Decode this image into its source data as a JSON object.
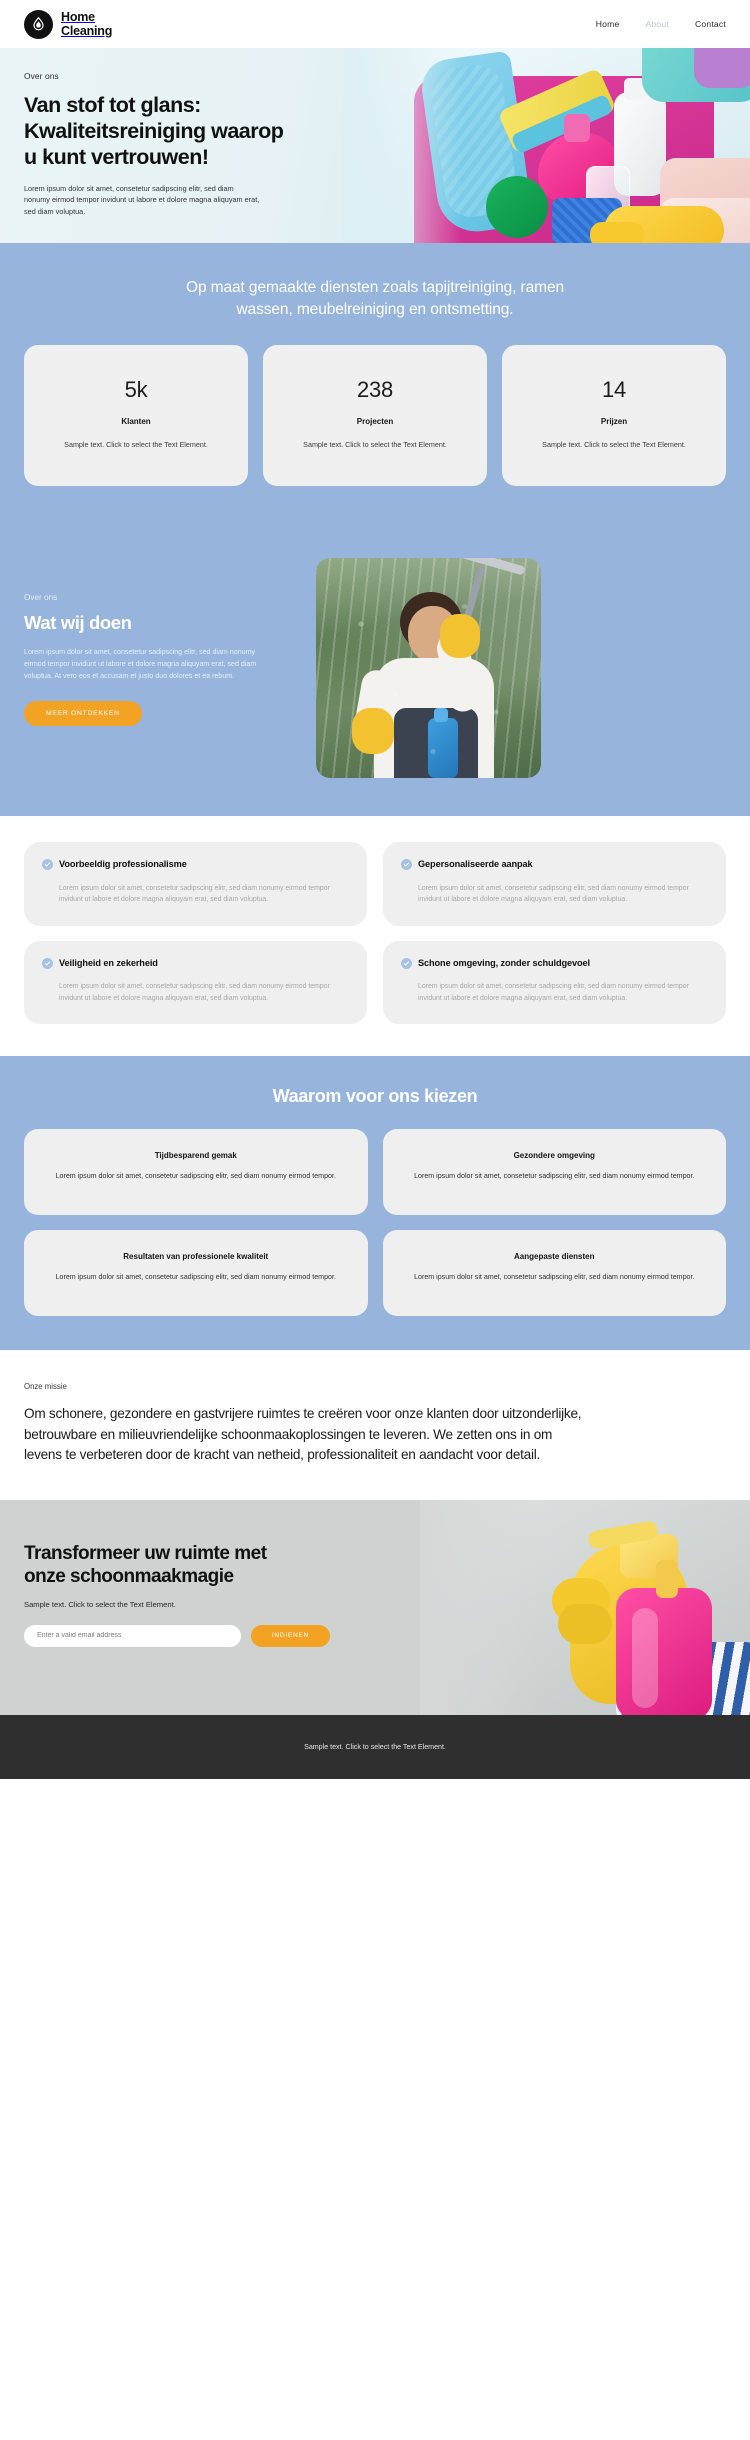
{
  "nav": {
    "brand_line1": "Home",
    "brand_line2": "Cleaning",
    "logo_icon": "water-drop-in-circle-icon",
    "links": [
      {
        "label": "Home",
        "state": "active"
      },
      {
        "label": "About",
        "state": "muted"
      },
      {
        "label": "Contact",
        "state": "default"
      }
    ]
  },
  "hero": {
    "eyebrow": "Over ons",
    "title": "Van stof tot glans: Kwaliteitsreiniging waarop u kunt vertrouwen!",
    "copy": "Lorem ipsum dolor sit amet, consetetur sadipscing elitr, sed diam nonumy eirmod tempor invidunt ut labore et dolore magna aliquyam erat, sed diam voluptua."
  },
  "services": {
    "heading": "Op maat gemaakte diensten zoals tapijtreiniging, ramen wassen, meubelreiniging en ontsmetting.",
    "stats": [
      {
        "number": "5k",
        "label": "Klanten",
        "desc": "Sample text. Click to select the Text Element."
      },
      {
        "number": "238",
        "label": "Projecten",
        "desc": "Sample text. Click to select the Text Element."
      },
      {
        "number": "14",
        "label": "Prijzen",
        "desc": "Sample text. Click to select the Text Element."
      }
    ]
  },
  "wat": {
    "eyebrow": "Over ons",
    "title": "Wat wij doen",
    "copy": "Lorem ipsum dolor sit amet, consetetur sadipscing elitr, sed diam nonumy eirmod tempor invidunt ut labore et dolore magna aliquyam erat, sed diam voluptua. At vero eos et accusam et justo duo dolores et ea rebum.",
    "button": "MEER ONTDEKKEN"
  },
  "features": {
    "icon": "check-circle-icon",
    "left": [
      {
        "title": "Voorbeeldig professionalisme",
        "body": "Lorem ipsum dolor sit amet, consetetur sadipscing elitr, sed diam nonumy eirmod tempor invidunt ut labore et dolore magna aliquyam erat, sed diam voluptua."
      },
      {
        "title": "Veiligheid en zekerheid",
        "body": "Lorem ipsum dolor sit amet, consetetur sadipscing elitr, sed diam nonumy eirmod tempor invidunt ut labore et dolore magna aliquyam erat, sed diam voluptua."
      }
    ],
    "right": [
      {
        "title": "Gepersonaliseerde aanpak",
        "body": "Lorem ipsum dolor sit amet, consetetur sadipscing elitr, sed diam nonumy eirmod tempor invidunt ut labore et dolore magna aliquyam erat, sed diam voluptua."
      },
      {
        "title": "Schone omgeving, zonder schuldgevoel",
        "body": "Lorem ipsum dolor sit amet, consetetur sadipscing elitr, sed diam nonumy eirmod tempor invidunt ut labore et dolore magna aliquyam erat, sed diam voluptua."
      }
    ]
  },
  "waarom": {
    "heading": "Waarom voor ons kiezen",
    "cards": [
      {
        "title": "Tijdbesparend gemak",
        "body": "Lorem ipsum dolor sit amet, consetetur sadipscing elitr, sed diam nonumy eirmod tempor."
      },
      {
        "title": "Gezondere omgeving",
        "body": "Lorem ipsum dolor sit amet, consetetur sadipscing elitr, sed diam nonumy eirmod tempor."
      },
      {
        "title": "Resultaten van professionele kwaliteit",
        "body": "Lorem ipsum dolor sit amet, consetetur sadipscing elitr, sed diam nonumy eirmod tempor."
      },
      {
        "title": "Aangepaste diensten",
        "body": "Lorem ipsum dolor sit amet, consetetur sadipscing elitr, sed diam nonumy eirmod tempor."
      }
    ]
  },
  "missie": {
    "eyebrow": "Onze missie",
    "text": "Om schonere, gezondere en gastvrijere ruimtes te creëren voor onze klanten door uitzonderlijke, betrouwbare en milieuvriendelijke schoonmaakoplossingen te leveren. We zetten ons in om levens te verbeteren door de kracht van netheid, professionaliteit en aandacht voor detail."
  },
  "cta": {
    "title": "Transformeer uw ruimte met onze schoonmaakmagie",
    "subtitle": "Sample text. Click to select the Text Element.",
    "input_placeholder": "Enter a valid email address",
    "input_value": "",
    "button": "INDIENEN"
  },
  "footer": {
    "text": "Sample text. Click to select the Text Element."
  },
  "colors": {
    "blue_section": "#96b4dc",
    "orange_accent": "#f2a324",
    "card_grey": "#efefef",
    "footer_dark": "#2f2f2f",
    "hero_gradient_start": "#eaf4f6",
    "hero_gradient_end": "#c6e2ec"
  }
}
